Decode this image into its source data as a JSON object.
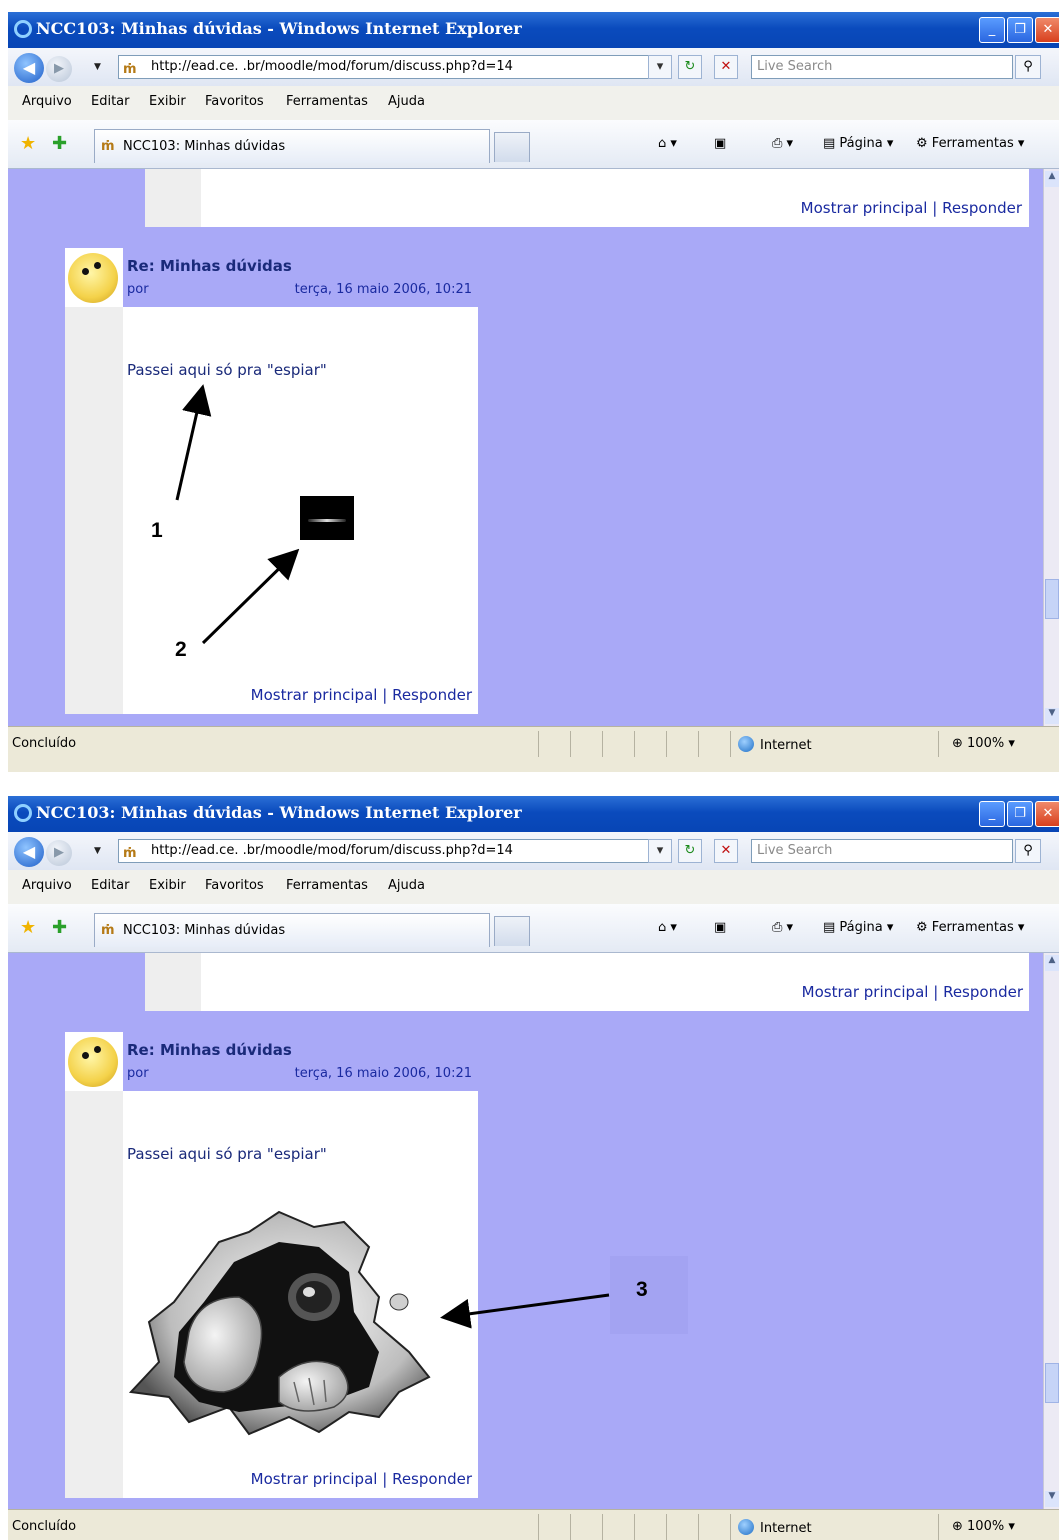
{
  "browser": {
    "window_title": "NCC103: Minhas dúvidas - Windows Internet Explorer",
    "url": "http://ead.ce.          .br/moodle/mod/forum/discuss.php?d=14",
    "search_placeholder": "Live Search",
    "menu": [
      "Arquivo",
      "Editar",
      "Exibir",
      "Favoritos",
      "Ferramentas",
      "Ajuda"
    ],
    "tab_title": "NCC103: Minhas dúvidas",
    "cmd_pagina": "Página",
    "cmd_ferramentas": "Ferramentas",
    "status_text": "Concluído",
    "zone": "Internet",
    "zoom": "100%"
  },
  "prev_post": {
    "link_show_parent": "Mostrar principal",
    "separator": "|",
    "link_reply": "Responder"
  },
  "post": {
    "subject": "Re: Minhas dúvidas",
    "author_label": "por",
    "date": "terça, 16 maio 2006, 10:21",
    "message": "Passei aqui só pra \"espiar\"",
    "link_show_parent": "Mostrar principal",
    "separator": "|",
    "link_reply": "Responder"
  },
  "annotations": {
    "label_1": "1",
    "label_2": "2",
    "label_3": "3"
  },
  "icons": [
    "ie-logo-icon",
    "back-icon",
    "forward-icon",
    "refresh-icon",
    "stop-icon",
    "search-icon",
    "favorites-star-icon",
    "add-favorites-icon",
    "home-icon",
    "feeds-icon",
    "print-icon",
    "page-icon",
    "tools-icon",
    "globe-icon",
    "zoom-icon",
    "smiley-avatar-icon",
    "broken-image-icon"
  ]
}
